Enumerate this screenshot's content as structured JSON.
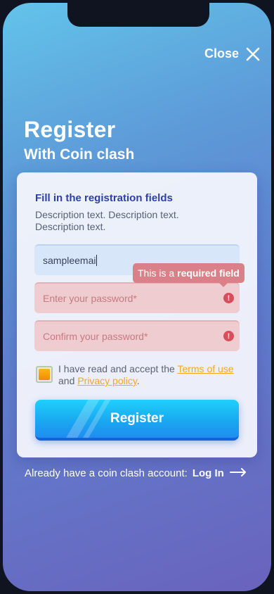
{
  "header": {
    "close_label": "Close"
  },
  "title": "Register",
  "subtitle": "With Coin clash",
  "form": {
    "heading": "Fill in the registration fields",
    "description": "Description text. Description text. Description text.",
    "email_value": "sampleemai",
    "password_placeholder": "Enter your password*",
    "confirm_placeholder": "Confirm your password*",
    "tooltip_prefix": "This is a",
    "tooltip_bold": "required field",
    "terms_prefix": "I have read and accept the",
    "terms_link": "Terms of use",
    "terms_and": "and",
    "privacy_link": "Privacy policy",
    "terms_end": ".",
    "register_label": "Register"
  },
  "footer": {
    "prompt": "Already have a coin clash account:",
    "login_label": "Log In"
  },
  "colors": {
    "accent_blue": "#1aa8f0",
    "error": "#d94c5a",
    "link": "#f3a91a",
    "checkbox": "#f28a00"
  }
}
